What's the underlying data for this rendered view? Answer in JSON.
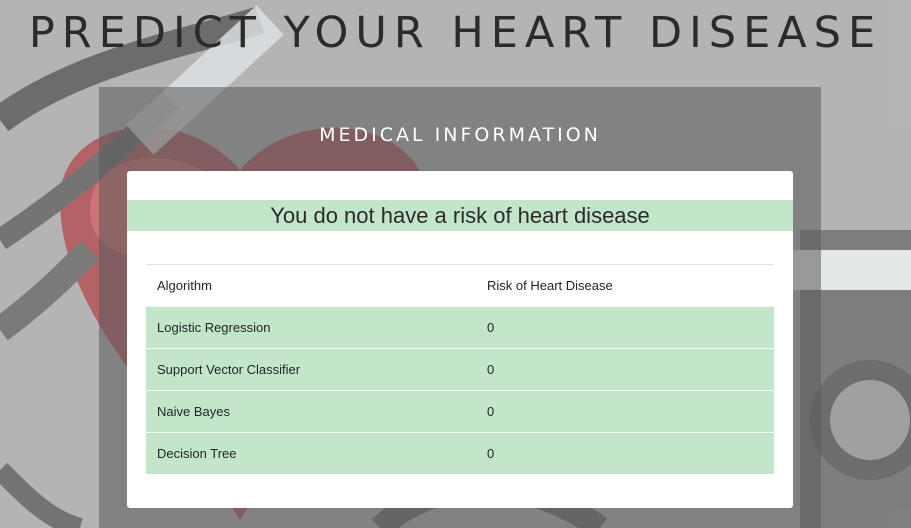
{
  "page": {
    "title": "PREDICT YOUR HEART DISEASE"
  },
  "panel": {
    "title": "MEDICAL INFORMATION"
  },
  "result": {
    "message": "You do not have a risk of heart disease"
  },
  "table": {
    "headers": [
      "Algorithm",
      "Risk of Heart Disease"
    ],
    "rows": [
      {
        "algorithm": "Logistic Regression",
        "risk": "0"
      },
      {
        "algorithm": "Support Vector Classifier",
        "risk": "0"
      },
      {
        "algorithm": "Naive Bayes",
        "risk": "0"
      },
      {
        "algorithm": "Decision Tree",
        "risk": "0"
      }
    ]
  },
  "colors": {
    "success_bg": "#c3e6cb",
    "panel_bg": "#5a5a5a",
    "title_text": "#2b2b2b"
  }
}
